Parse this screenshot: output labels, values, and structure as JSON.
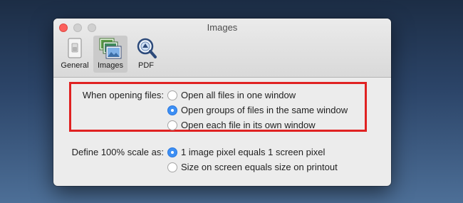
{
  "window": {
    "title": "Images",
    "controls": {
      "close": "close-button",
      "minimize": "minimize-button",
      "zoom": "zoom-button"
    }
  },
  "toolbar": {
    "tabs": [
      {
        "label": "General",
        "icon": "general-switch-icon",
        "selected": false
      },
      {
        "label": "Images",
        "icon": "images-stack-icon",
        "selected": true
      },
      {
        "label": "PDF",
        "icon": "pdf-magnifier-icon",
        "selected": false
      }
    ]
  },
  "opening_files": {
    "label": "When opening files:",
    "options": [
      {
        "label": "Open all files in one window",
        "selected": false
      },
      {
        "label": "Open groups of files in the same window",
        "selected": true
      },
      {
        "label": "Open each file in its own window",
        "selected": false
      }
    ]
  },
  "scale": {
    "label": "Define 100% scale as:",
    "options": [
      {
        "label": "1 image pixel equals 1 screen pixel",
        "selected": true
      },
      {
        "label": "Size on screen equals size on printout",
        "selected": false
      }
    ]
  },
  "colors": {
    "highlight": "#e02222",
    "radio_selected": "#3d8ff4",
    "close_light": "#fc605c"
  }
}
